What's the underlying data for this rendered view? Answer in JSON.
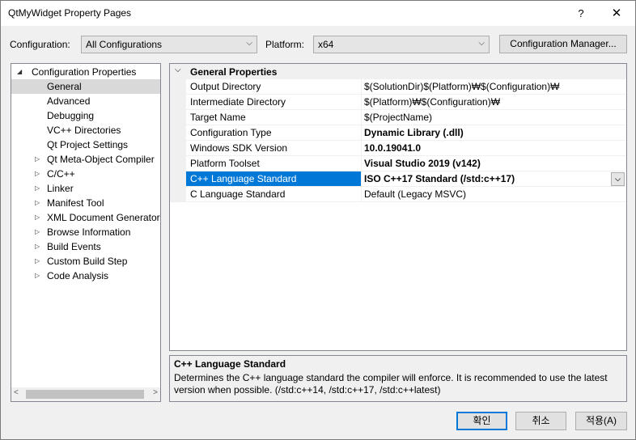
{
  "window": {
    "title": "QtMyWidget Property Pages",
    "help_glyph": "?",
    "close_glyph": "✕"
  },
  "toolbar": {
    "configuration_label": "Configuration:",
    "configuration_value": "All Configurations",
    "platform_label": "Platform:",
    "platform_value": "x64",
    "config_manager_label": "Configuration Manager..."
  },
  "tree": {
    "root": "Configuration Properties",
    "items": [
      {
        "label": "General",
        "selected": true
      },
      {
        "label": "Advanced"
      },
      {
        "label": "Debugging"
      },
      {
        "label": "VC++ Directories"
      },
      {
        "label": "Qt Project Settings"
      },
      {
        "label": "Qt Meta-Object Compiler",
        "expandable": true
      },
      {
        "label": "C/C++",
        "expandable": true
      },
      {
        "label": "Linker",
        "expandable": true
      },
      {
        "label": "Manifest Tool",
        "expandable": true
      },
      {
        "label": "XML Document Generator",
        "expandable": true
      },
      {
        "label": "Browse Information",
        "expandable": true
      },
      {
        "label": "Build Events",
        "expandable": true
      },
      {
        "label": "Custom Build Step",
        "expandable": true
      },
      {
        "label": "Code Analysis",
        "expandable": true
      }
    ]
  },
  "grid": {
    "category": "General Properties",
    "rows": [
      {
        "name": "Output Directory",
        "value": "$(SolutionDir)$(Platform)₩$(Configuration)₩",
        "bold": false
      },
      {
        "name": "Intermediate Directory",
        "value": "$(Platform)₩$(Configuration)₩",
        "bold": false
      },
      {
        "name": "Target Name",
        "value": "$(ProjectName)",
        "bold": false
      },
      {
        "name": "Configuration Type",
        "value": "Dynamic Library (.dll)",
        "bold": true
      },
      {
        "name": "Windows SDK Version",
        "value": "10.0.19041.0",
        "bold": true
      },
      {
        "name": "Platform Toolset",
        "value": "Visual Studio 2019 (v142)",
        "bold": true
      },
      {
        "name": "C++ Language Standard",
        "value": "ISO C++17 Standard (/std:c++17)",
        "bold": true,
        "selected": true
      },
      {
        "name": "C Language Standard",
        "value": "Default (Legacy MSVC)",
        "bold": false
      }
    ]
  },
  "description": {
    "title": "C++ Language Standard",
    "body": "Determines the C++ language standard the compiler will enforce. It is recommended to use the latest version when possible.  (/std:c++14, /std:c++17, /std:c++latest)"
  },
  "buttons": {
    "ok": "확인",
    "cancel": "취소",
    "apply": "적용(A)"
  },
  "colors": {
    "selection": "#0078d7",
    "tree_selection": "#d9d9d9"
  }
}
